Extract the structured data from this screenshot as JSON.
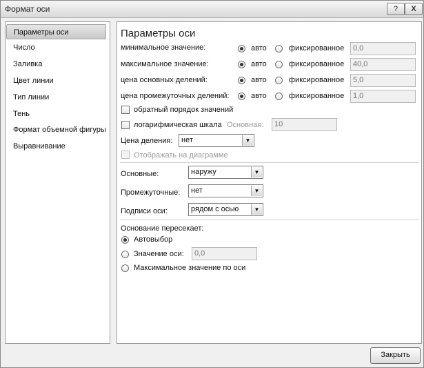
{
  "window": {
    "title": "Формат оси",
    "help_label": "?",
    "close_label": "X"
  },
  "nav": {
    "items": [
      {
        "label": "Параметры оси",
        "selected": true
      },
      {
        "label": "Число"
      },
      {
        "label": "Заливка"
      },
      {
        "label": "Цвет линии"
      },
      {
        "label": "Тип линии"
      },
      {
        "label": "Тень"
      },
      {
        "label": "Формат объемной фигуры"
      },
      {
        "label": "Выравнивание"
      }
    ]
  },
  "panel": {
    "title": "Параметры оси",
    "auto_label": "авто",
    "fixed_label": "фиксированное",
    "rows": [
      {
        "label": "минимальное значение:",
        "value": "0,0"
      },
      {
        "label": "максимальное значение:",
        "value": "40,0"
      },
      {
        "label": "цена основных делений:",
        "value": "5,0"
      },
      {
        "label": "цена промежуточных делений:",
        "value": "1,0"
      }
    ],
    "reverse_label": "обратный порядок значений",
    "log_label": "логарифмическая шкала",
    "log_base_label": "Основная:",
    "log_base_value": "10",
    "units_label": "Цена деления:",
    "units_value": "нет",
    "show_units_label": "Отображать на диаграмме",
    "major_label": "Основные:",
    "major_value": "наружу",
    "minor_label": "Промежуточные:",
    "minor_value": "нет",
    "axis_labels_label": "Подписи оси:",
    "axis_labels_value": "рядом с осью",
    "crosses_label": "Основание пересекает:",
    "cross_auto_label": "Автовыбор",
    "cross_value_label": "Значение оси:",
    "cross_value": "0,0",
    "cross_max_label": "Максимальное значение по оси"
  },
  "footer": {
    "close_button": "Закрыть"
  },
  "icons": {
    "dropdown": "chevron-down-icon"
  },
  "colors": {
    "panel_bg": "#ffffff",
    "dialog_bg": "#f0f0f0",
    "selection": "#d2d2d2"
  }
}
